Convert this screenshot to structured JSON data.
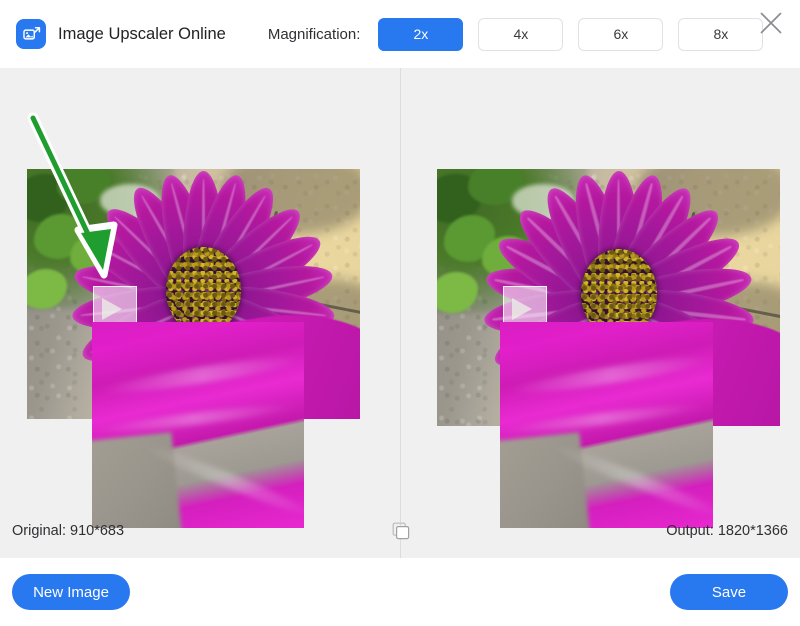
{
  "header": {
    "logo_icon": "image-upscale-icon",
    "app_title": "Image Upscaler Online",
    "magnification_label": "Magnification:",
    "magnification_options": [
      {
        "label": "2x",
        "selected": true
      },
      {
        "label": "4x",
        "selected": false
      },
      {
        "label": "6x",
        "selected": false
      },
      {
        "label": "8x",
        "selected": false
      }
    ],
    "close_icon": "close-icon"
  },
  "canvas": {
    "original_panel_name": "original-image",
    "output_panel_name": "output-image",
    "loupe_icon": "magnifier-selection",
    "divider": "vertical-divider",
    "annotation_arrow_icon": "green-arrow-annotation"
  },
  "status": {
    "original_label": "Original: 910*683",
    "output_label": "Output: 1820*1366",
    "compare_icon": "compare-toggle-icon"
  },
  "footer": {
    "new_image_label": "New Image",
    "save_label": "Save"
  },
  "colors": {
    "accent": "#2878f0",
    "canvas_bg": "#f0f0f0",
    "header_bg": "#ffffff",
    "text": "#2f3033",
    "border": "#dfe1e5",
    "annotation_green": "#1f9d2e"
  }
}
